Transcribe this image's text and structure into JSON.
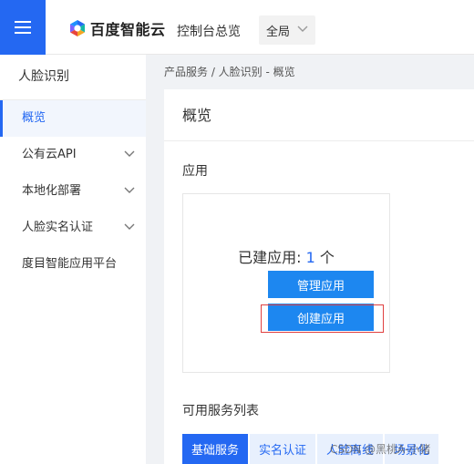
{
  "topbar": {
    "brand": "百度智能云",
    "console_link": "控制台总览",
    "region": "全局"
  },
  "sidebar": {
    "title": "人脸识别",
    "items": [
      {
        "label": "概览",
        "active": true,
        "expandable": false
      },
      {
        "label": "公有云API",
        "active": false,
        "expandable": true
      },
      {
        "label": "本地化部署",
        "active": false,
        "expandable": true
      },
      {
        "label": "人脸实名认证",
        "active": false,
        "expandable": true
      },
      {
        "label": "度目智能应用平台",
        "active": false,
        "expandable": false
      }
    ]
  },
  "breadcrumb": "产品服务 / 人脸识别 - 概览",
  "main": {
    "title": "概览",
    "apps_section": "应用",
    "created_prefix": "已建应用: ",
    "created_count": "1",
    "created_suffix": " 个",
    "manage_button": "管理应用",
    "create_button": "创建应用",
    "services_section": "可用服务列表",
    "tabs": [
      "基础服务",
      "实名认证",
      "人脸离线",
      "场景化"
    ]
  },
  "watermark": "CSDN @黑桃A-小猪",
  "colors": {
    "accent": "#2468f2",
    "button": "#1d87f0",
    "highlight": "#e04040"
  }
}
